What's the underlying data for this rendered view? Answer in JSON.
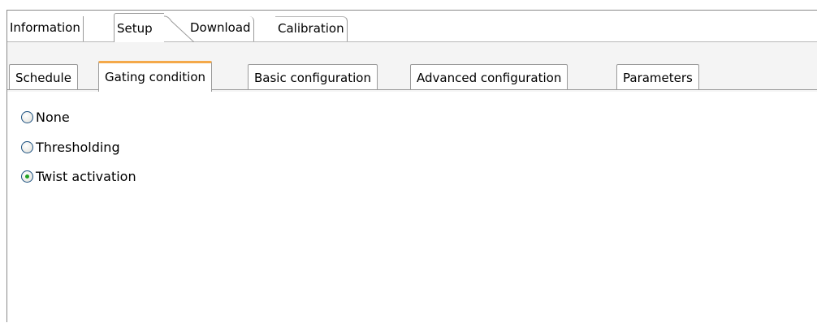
{
  "top_tabs": [
    {
      "label": "Information",
      "active": false
    },
    {
      "label": "Setup",
      "active": true
    },
    {
      "label": "Download",
      "active": false
    },
    {
      "label": "Calibration",
      "active": false
    }
  ],
  "sub_tabs": [
    {
      "label": "Schedule",
      "active": false
    },
    {
      "label": "Gating condition",
      "active": true
    },
    {
      "label": "Basic configuration",
      "active": false
    },
    {
      "label": "Advanced configuration",
      "active": false
    },
    {
      "label": "Parameters",
      "active": false
    }
  ],
  "gating_options": [
    {
      "label": "None",
      "selected": false
    },
    {
      "label": "Thresholding",
      "selected": false
    },
    {
      "label": "Twist activation",
      "selected": true
    }
  ],
  "colors": {
    "active_subtab_accent": "#f4a94a",
    "radio_selected_dot": "#21a121",
    "radio_border": "#1c5180"
  }
}
